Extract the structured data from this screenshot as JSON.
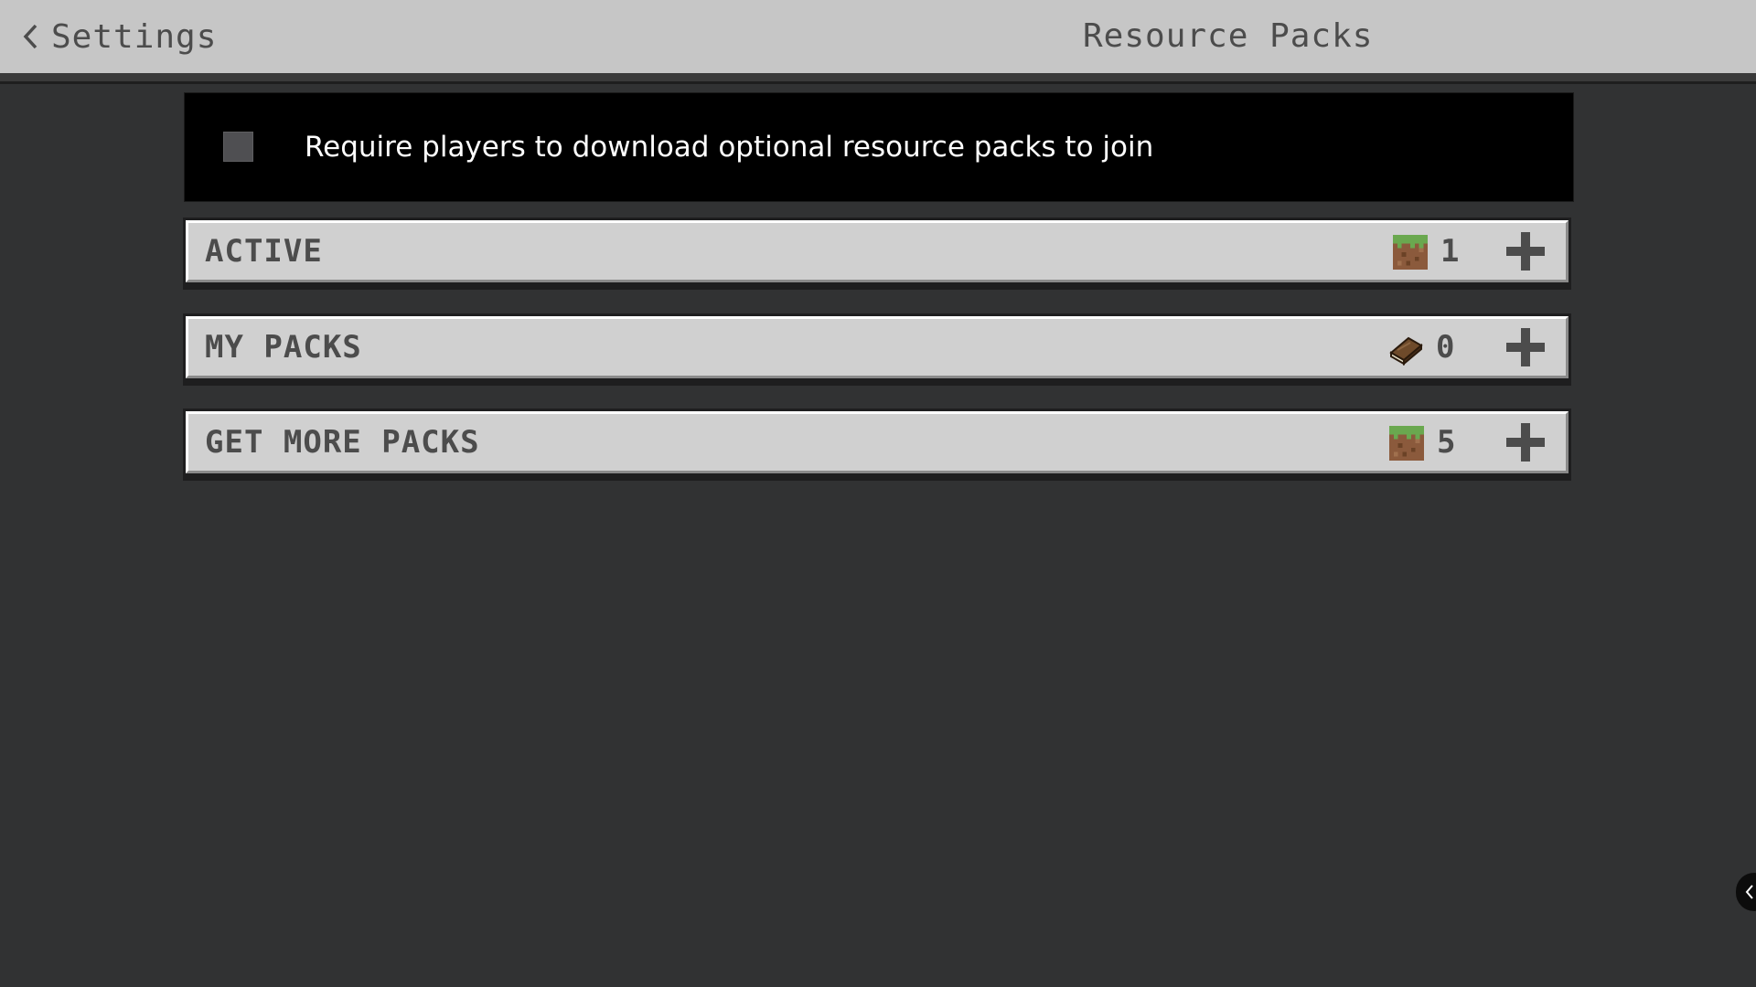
{
  "header": {
    "back_label": "Settings",
    "title": "Resource Packs"
  },
  "option": {
    "label": "Require players to download optional resource packs to join",
    "checked": false
  },
  "rows": [
    {
      "label": "ACTIVE",
      "count": "1",
      "icon": "grass-block-icon"
    },
    {
      "label": "MY PACKS",
      "count": "0",
      "icon": "book-icon"
    },
    {
      "label": "GET MORE PACKS",
      "count": "5",
      "icon": "grass-block-icon"
    }
  ],
  "colors": {
    "background": "#313233",
    "header": "#c6c6c6",
    "row": "#d0d0d0",
    "text_dark": "#4c4c4c",
    "option_panel": "#000000"
  }
}
